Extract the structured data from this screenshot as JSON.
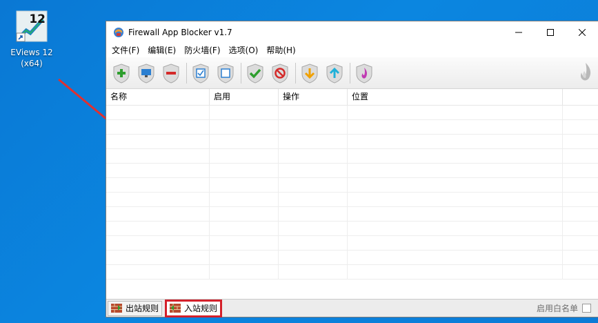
{
  "desktop": {
    "icon_badge": "12",
    "icon_label_line1": "EViews 12",
    "icon_label_line2": "(x64)"
  },
  "window": {
    "title": "Firewall App Blocker v1.7"
  },
  "menu": {
    "items": [
      "文件(F)",
      "编辑(E)",
      "防火墙(F)",
      "选项(O)",
      "帮助(H)"
    ]
  },
  "toolbar": {
    "buttons": [
      {
        "name": "add-icon",
        "color": "#2e9e2e"
      },
      {
        "name": "monitor-icon",
        "color": "#2b7fd1"
      },
      {
        "name": "remove-icon",
        "color": "#d42a2a"
      },
      {
        "name": "check-all-icon",
        "color": "#2b7fd1"
      },
      {
        "name": "uncheck-all-icon",
        "color": "#2b7fd1"
      },
      {
        "name": "allow-icon",
        "color": "#2e9e2e"
      },
      {
        "name": "block-icon",
        "color": "#d42a2a"
      },
      {
        "name": "move-down-icon",
        "color": "#f0a000"
      },
      {
        "name": "move-up-icon",
        "color": "#1fb0d8"
      },
      {
        "name": "firewall-icon",
        "color": "#c03bb3"
      }
    ]
  },
  "table": {
    "columns": [
      "名称",
      "启用",
      "操作",
      "位置"
    ],
    "row_count": 12
  },
  "statusbar": {
    "tabs": [
      "出站规则",
      "入站规则"
    ],
    "active_tab": "入站规则",
    "whitelist_label": "启用白名单",
    "whitelist_checked": false
  },
  "colors": {
    "desktop": "#0a78d4",
    "highlight": "#d4202a"
  }
}
